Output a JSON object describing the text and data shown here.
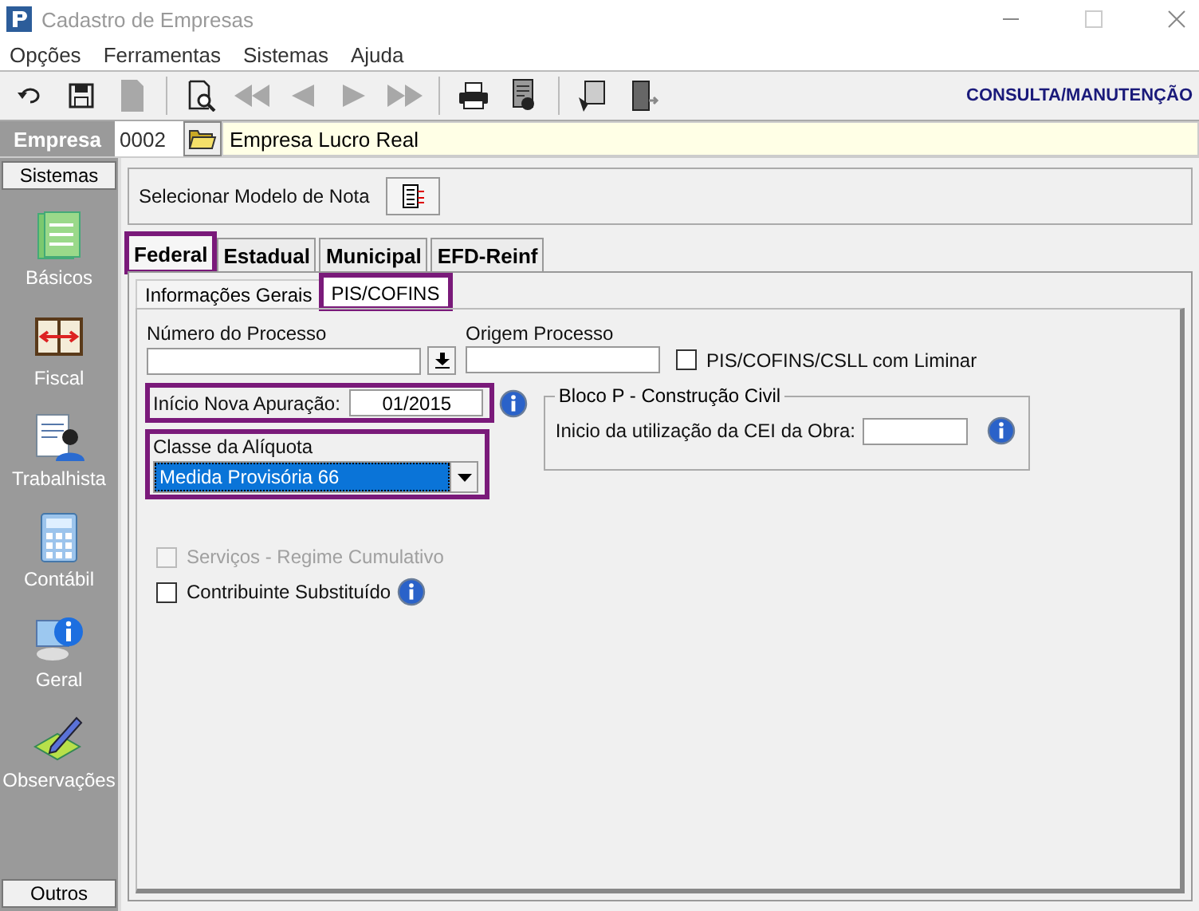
{
  "window": {
    "title": "Cadastro de Empresas"
  },
  "menu": [
    "Opções",
    "Ferramentas",
    "Sistemas",
    "Ajuda"
  ],
  "toolbar": {
    "buttons": [
      {
        "kind": "undo",
        "disabled": false
      },
      {
        "kind": "save",
        "disabled": false
      },
      {
        "kind": "page",
        "disabled": true
      },
      {
        "kind": "separator"
      },
      {
        "kind": "preview",
        "disabled": false
      },
      {
        "kind": "first",
        "disabled": true
      },
      {
        "kind": "prev",
        "disabled": true
      },
      {
        "kind": "next",
        "disabled": true
      },
      {
        "kind": "last",
        "disabled": true
      },
      {
        "kind": "separator"
      },
      {
        "kind": "print",
        "disabled": false
      },
      {
        "kind": "report",
        "disabled": false
      },
      {
        "kind": "separator"
      },
      {
        "kind": "tool",
        "disabled": false
      },
      {
        "kind": "exit",
        "disabled": false
      }
    ],
    "mode": "CONSULTA/MANUTENÇÃO"
  },
  "company": {
    "label": "Empresa",
    "code": "0002",
    "name": "Empresa Lucro Real"
  },
  "sidebar": {
    "header": "Sistemas",
    "items": [
      {
        "label": "Básicos",
        "kind": "basicos"
      },
      {
        "label": "Fiscal",
        "kind": "fiscal"
      },
      {
        "label": "Trabalhista",
        "kind": "trabalhista"
      },
      {
        "label": "Contábil",
        "kind": "contabil"
      },
      {
        "label": "Geral",
        "kind": "geral"
      },
      {
        "label": "Observações",
        "kind": "observacoes"
      }
    ],
    "footer": "Outros"
  },
  "note_model": {
    "label": "Selecionar Modelo de Nota"
  },
  "tabs": [
    {
      "label": "Federal",
      "selected": true,
      "highlighted": true
    },
    {
      "label": "Estadual",
      "selected": false,
      "highlighted": false
    },
    {
      "label": "Municipal",
      "selected": false,
      "highlighted": false
    },
    {
      "label": "EFD-Reinf",
      "selected": false,
      "highlighted": false
    }
  ],
  "subtabs": [
    {
      "label": "Informações Gerais",
      "selected": false,
      "highlighted": false
    },
    {
      "label": "PIS/COFINS",
      "selected": true,
      "highlighted": true
    }
  ],
  "form": {
    "process_number": {
      "label": "Número do Processo"
    },
    "process_origin": {
      "label": "Origem Processo"
    },
    "liminar": {
      "label": "PIS/COFINS/CSLL com Liminar",
      "checked": false
    },
    "new_period": {
      "label": "Início Nova Apuração:",
      "value": "01/2015",
      "highlighted": true
    },
    "rate_class": {
      "label": "Classe da Alíquota",
      "value": "Medida Provisória 66",
      "highlighted": true
    },
    "bloco_p": {
      "title": "Bloco P - Construção Civil",
      "label": "Inicio da utilização da CEI da Obra:"
    },
    "services": {
      "label": "Serviços - Regime Cumulativo",
      "checked": false,
      "disabled": true
    },
    "substitute": {
      "label": "Contribuinte Substituído",
      "checked": false,
      "disabled": false
    }
  }
}
